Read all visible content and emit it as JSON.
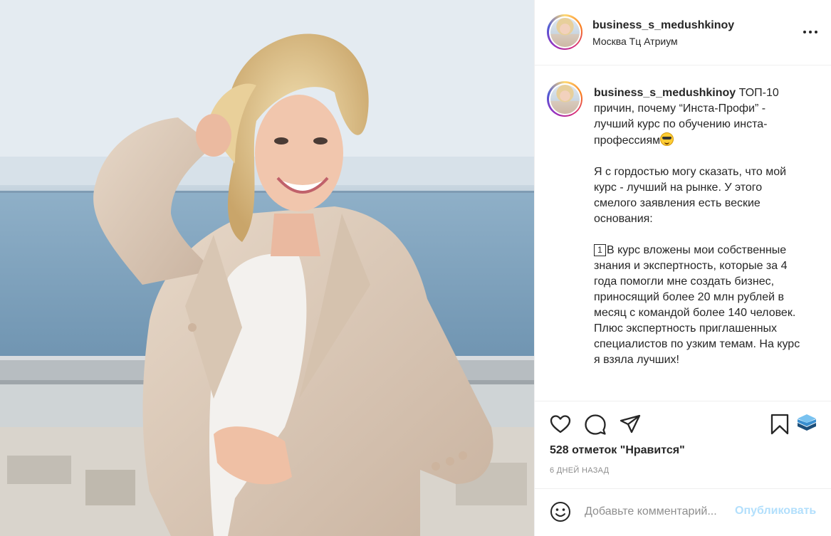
{
  "post": {
    "photo_alt": "woman in beige blazer on balcony",
    "header": {
      "username": "business_s_medushkinoy",
      "location": "Москва Тц Атриум"
    },
    "caption": {
      "username": "business_s_medushkinoy",
      "line1_text": " ТОП-10 причин, почему “Инста-Профи” - лучший курс по обучению инста-профессиям",
      "line1_emoji": "smiling-face-with-sunglasses",
      "para2": "Я с гордостью могу сказать, что мой курс - лучший на рынке. У этого смелого заявления есть веские основания:",
      "para3_keycap": "1",
      "para3_text": "В курс вложены мои собственные знания и экспертность, которые за 4 года помогли мне создать бизнес, приносящий более 20 млн рублей в месяц с командой более 140 человек. Плюс экспертность приглашенных специалистов по узким темам. На курс я взяла лучших!"
    },
    "actions": {
      "like_icon": "heart-icon",
      "comment_icon": "comment-icon",
      "share_icon": "paper-plane-icon",
      "save_icon": "bookmark-icon",
      "extension_icon": "layers-icon"
    },
    "likes_text": "528 отметок \"Нравится\"",
    "time_ago": "6 ДНЕЙ НАЗАД",
    "comment": {
      "placeholder": "Добавьте комментарий...",
      "publish_label": "Опубликовать"
    }
  },
  "colors": {
    "text": "#262626",
    "muted": "#8e8e8e",
    "publish_disabled": "#b2dffc",
    "border": "#efefef"
  }
}
